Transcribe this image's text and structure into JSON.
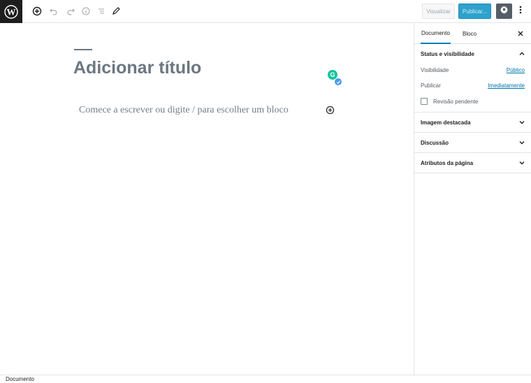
{
  "toolbar": {
    "icons": [
      "wordpress-logo-icon",
      "add-block-icon",
      "undo-icon",
      "redo-icon",
      "info-icon",
      "list-view-icon",
      "edit-icon"
    ],
    "preview_label": "Visualizar",
    "publish_label": "Publicar...",
    "settings_icon": "gear-icon",
    "more_icon": "more-vertical-icon",
    "colors": {
      "logo_bg": "#1e1e1e",
      "publish_bg": "#2ea2cc",
      "settings_bg": "#555d66"
    }
  },
  "editor": {
    "title_placeholder": "Adicionar título",
    "block_placeholder": "Comece a escrever ou digite / para escolher um bloco",
    "grammarly_letter": "G"
  },
  "sidebar": {
    "tabs": [
      {
        "label": "Documento",
        "active": true
      },
      {
        "label": "Bloco",
        "active": false
      }
    ],
    "close_icon": "close-icon",
    "status_panel": {
      "title": "Status e visibilidade",
      "expanded": true,
      "visibility_label": "Visibilidade",
      "visibility_value": "Público",
      "publish_label": "Publicar",
      "publish_value": "Imediatamente",
      "pending_label": "Revisão pendente",
      "pending_checked": false
    },
    "panels": [
      {
        "title": "Imagem destacada",
        "expanded": false
      },
      {
        "title": "Discussão",
        "expanded": false
      },
      {
        "title": "Atributos da página",
        "expanded": false
      }
    ]
  },
  "footer": {
    "breadcrumb": "Documento"
  }
}
